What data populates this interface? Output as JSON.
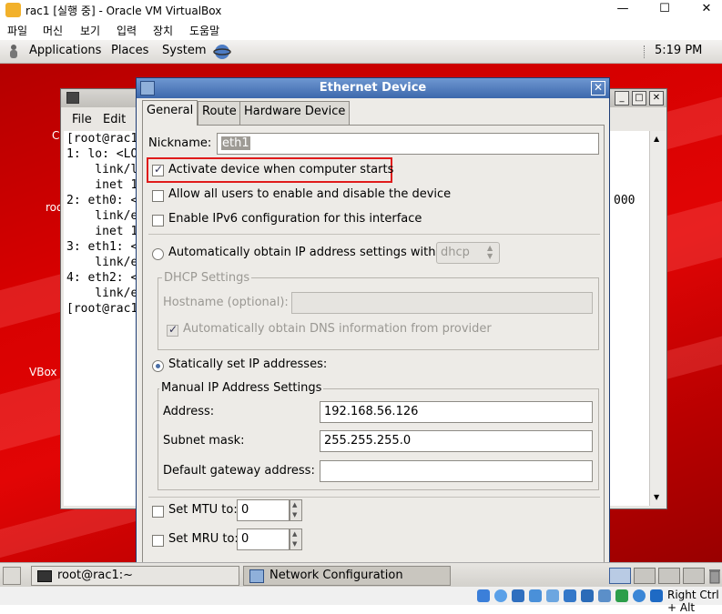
{
  "host": {
    "title": "rac1 [실행 중] - Oracle VM VirtualBox",
    "menu": [
      "파일",
      "머신",
      "보기",
      "입력",
      "장치",
      "도움말"
    ],
    "controls": {
      "minimize": "—",
      "maximize": "☐",
      "close": "✕"
    },
    "status": {
      "hostkey": "Right Ctrl + Alt"
    }
  },
  "panel": {
    "menus": [
      "Applications",
      "Places",
      "System"
    ],
    "clock": "5:19 PM"
  },
  "desktop": {
    "icon_labels": [
      "C",
      "roo",
      "VBox"
    ]
  },
  "terminal": {
    "menu": [
      "File",
      "Edit"
    ],
    "lines": [
      "[root@rac1",
      "1: lo: <LO",
      "    link/l",
      "    inet 1",
      "2: eth0: <",
      "    link/e",
      "    inet 1",
      "3: eth1: <",
      "    link/e",
      "4: eth2: <",
      "    link/e",
      "[root@rac1"
    ],
    "overflow_text": "000"
  },
  "dialog": {
    "title": "Ethernet Device",
    "tabs": [
      "General",
      "Route",
      "Hardware Device"
    ],
    "nickname_label": "Nickname:",
    "nickname_value": "eth1",
    "activate_label": "Activate device when computer starts",
    "activate_checked": true,
    "allow_users_label": "Allow all users to enable and disable the device",
    "ipv6_label": "Enable IPv6 configuration for this interface",
    "auto_label": "Automatically obtain IP address settings with:",
    "auto_method": "dhcp",
    "dhcp_group": "DHCP Settings",
    "hostname_label": "Hostname (optional):",
    "dns_label": "Automatically obtain DNS information from provider",
    "static_label": "Statically set IP addresses:",
    "manual_group": "Manual IP Address Settings",
    "address_label": "Address:",
    "address_value": "192.168.56.126",
    "subnet_label": "Subnet mask:",
    "subnet_value": "255.255.255.0",
    "gateway_label": "Default gateway address:",
    "gateway_value": "",
    "mtu_label": "Set MTU to:",
    "mtu_value": "0",
    "mru_label": "Set MRU to:",
    "mru_value": "0",
    "highlight_color": "#e01b1b"
  },
  "taskbar": {
    "tasks": [
      "root@rac1:~",
      "Network Configuration"
    ]
  }
}
